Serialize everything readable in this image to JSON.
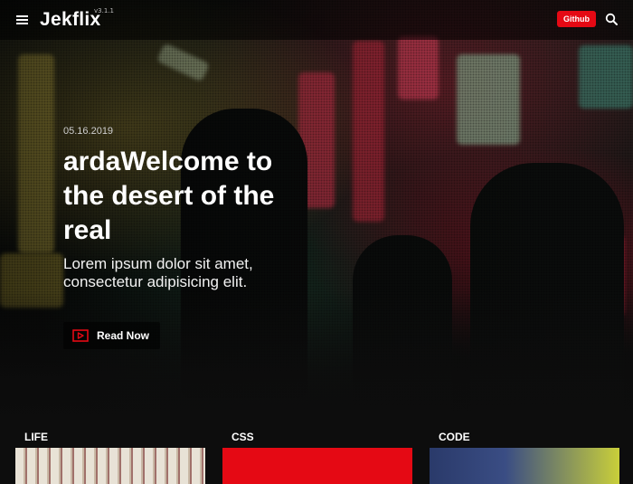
{
  "navbar": {
    "brand": "Jekflix",
    "version": "v3.1.1",
    "github_label": "Github",
    "menu_icon": "hamburger-icon",
    "search_icon": "search-icon"
  },
  "hero": {
    "date": "05.16.2019",
    "title": "ardaWelcome to the desert of the real",
    "subtitle": "Lorem ipsum dolor sit amet, consectetur adipisicing elit.",
    "cta_label": "Read Now",
    "cta_icon": "play-icon"
  },
  "categories": [
    {
      "title": "LIFE"
    },
    {
      "title": "CSS"
    },
    {
      "title": "CODE"
    }
  ],
  "colors": {
    "accent": "#e50914",
    "background": "#0d0d0d",
    "text": "#ffffff"
  }
}
